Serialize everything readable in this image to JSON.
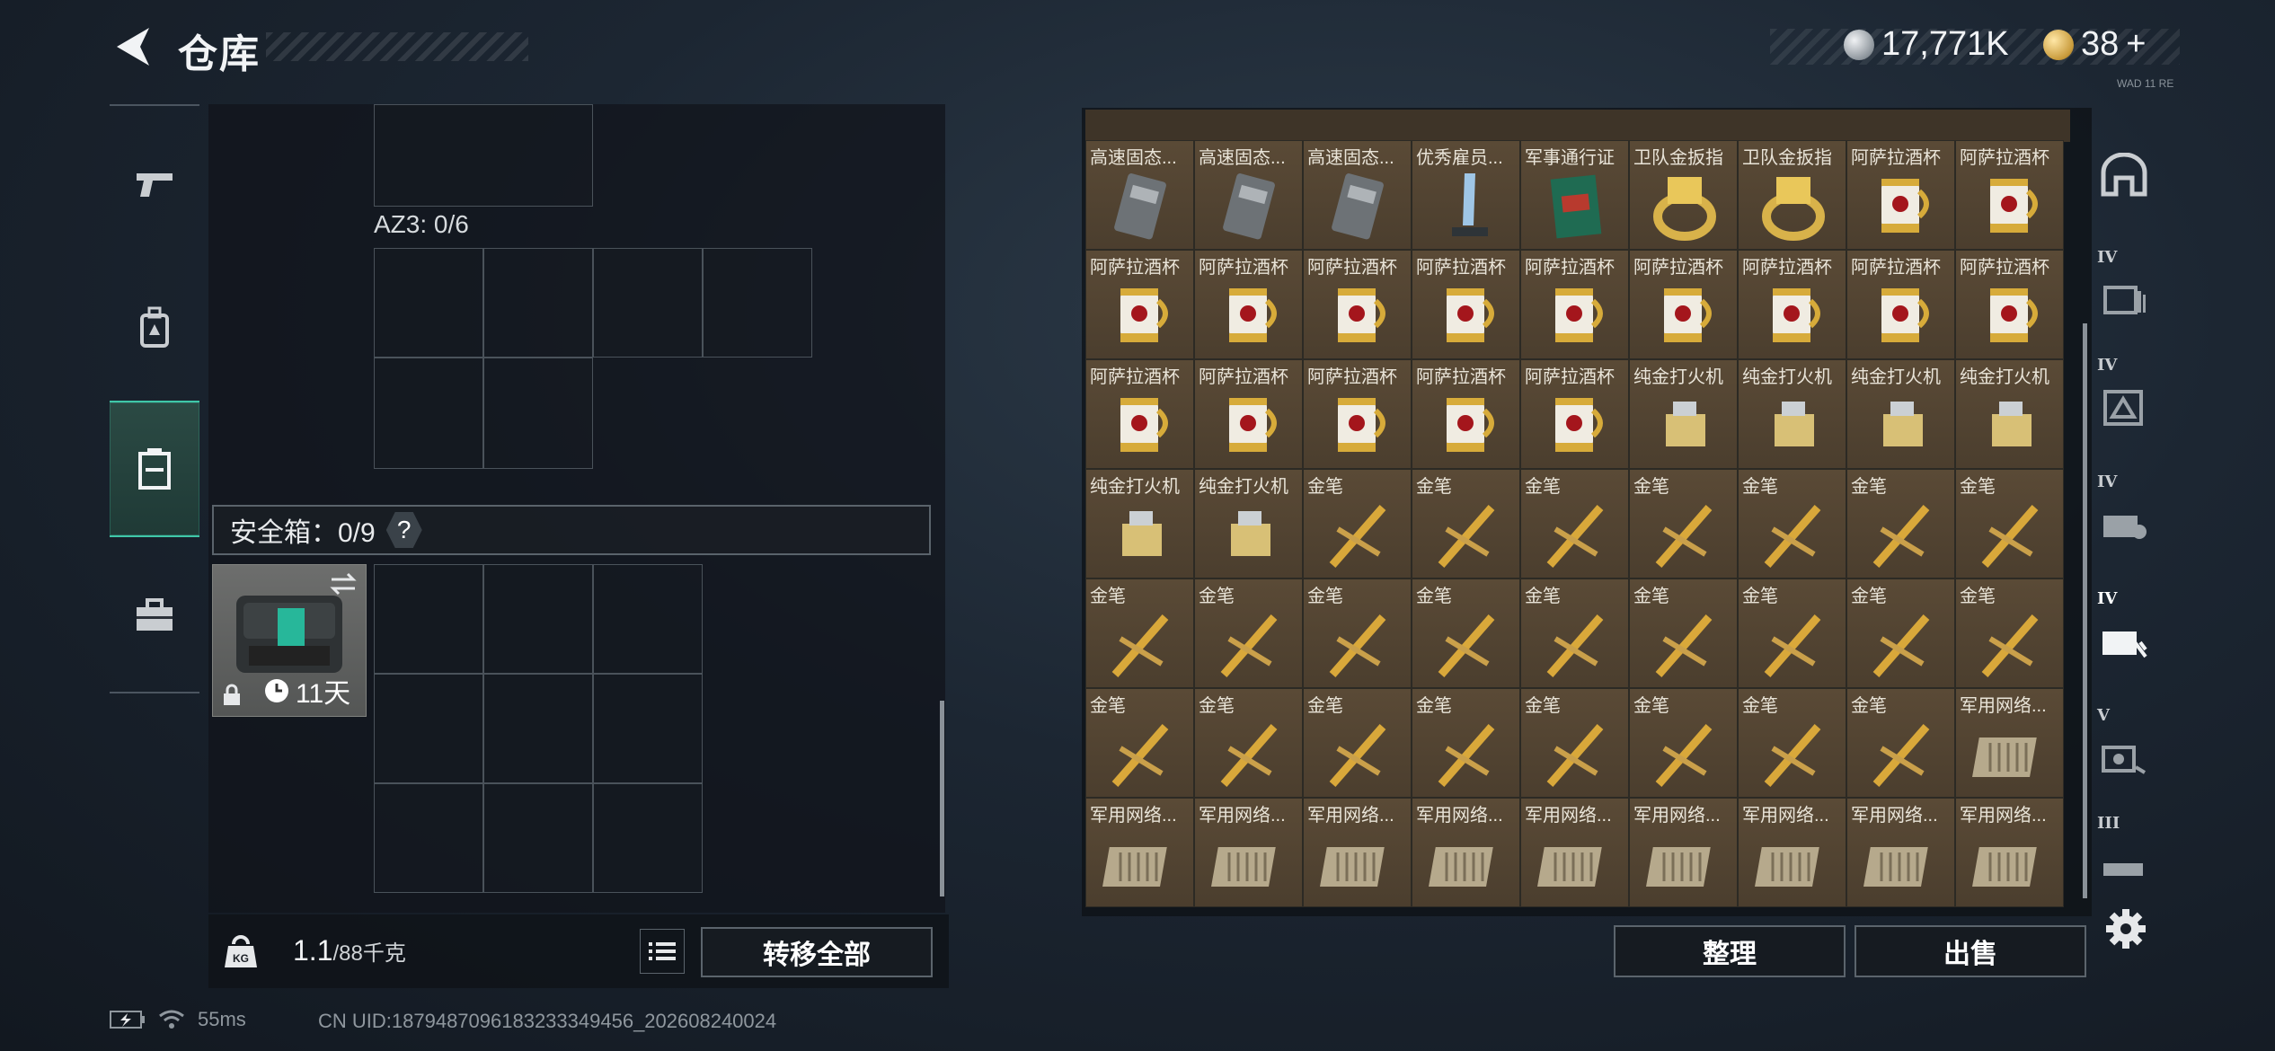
{
  "header": {
    "title": "仓库",
    "currency_main": "17,771K",
    "currency_secondary": "38",
    "plus": "+"
  },
  "left": {
    "az3_label": "AZ3: 0/6",
    "safe_box_label": "安全箱：0/9",
    "help": "?",
    "safebox_days": "11天",
    "weight_current": "1.1",
    "weight_max": "/88千克",
    "transfer_all": "转移全部",
    "kg_icon": "KG"
  },
  "status": {
    "ping": "55ms",
    "uid": "CN UID:1879487096183233349456_202608240024"
  },
  "inventory": {
    "rows": [
      [
        "高速固态...",
        "高速固态...",
        "高速固态...",
        "优秀雇员...",
        "军事通行证",
        "卫队金扳指",
        "卫队金扳指",
        "阿萨拉酒杯",
        "阿萨拉酒杯"
      ],
      [
        "阿萨拉酒杯",
        "阿萨拉酒杯",
        "阿萨拉酒杯",
        "阿萨拉酒杯",
        "阿萨拉酒杯",
        "阿萨拉酒杯",
        "阿萨拉酒杯",
        "阿萨拉酒杯",
        "阿萨拉酒杯"
      ],
      [
        "阿萨拉酒杯",
        "阿萨拉酒杯",
        "阿萨拉酒杯",
        "阿萨拉酒杯",
        "阿萨拉酒杯",
        "纯金打火机",
        "纯金打火机",
        "纯金打火机",
        "纯金打火机"
      ],
      [
        "纯金打火机",
        "纯金打火机",
        "金笔",
        "金笔",
        "金笔",
        "金笔",
        "金笔",
        "金笔",
        "金笔"
      ],
      [
        "金笔",
        "金笔",
        "金笔",
        "金笔",
        "金笔",
        "金笔",
        "金笔",
        "金笔",
        "金笔"
      ],
      [
        "金笔",
        "金笔",
        "金笔",
        "金笔",
        "金笔",
        "金笔",
        "金笔",
        "金笔",
        "军用网络..."
      ],
      [
        "军用网络...",
        "军用网络...",
        "军用网络...",
        "军用网络...",
        "军用网络...",
        "军用网络...",
        "军用网络...",
        "军用网络...",
        "军用网络..."
      ]
    ],
    "sort": "整理",
    "sell": "出售"
  },
  "filters": [
    "IV",
    "IV",
    "IV",
    "IV",
    "V",
    "III"
  ],
  "tiny": "WAD 11 RE",
  "colors": {
    "accent": "#3fc7a8",
    "item_bg": "#54452f"
  }
}
